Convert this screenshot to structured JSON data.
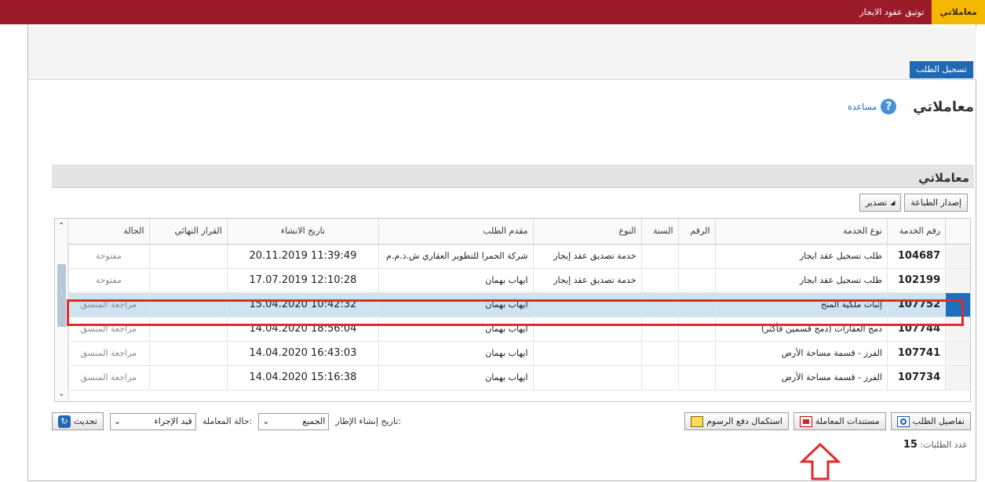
{
  "topbar": {
    "tabs": [
      {
        "label": "معاملاتي",
        "active": true
      },
      {
        "label": "توثيق عقود الايجار",
        "active": false
      }
    ]
  },
  "register_button": "تسجيل الطلب",
  "page_title": "معاملاتي",
  "help_label": "مساعدة",
  "help_icon": "?",
  "panel": {
    "title": "معاملاتي",
    "toolbar": {
      "print_label": "إصدار الطباعة",
      "export_label": "تصدير"
    }
  },
  "grid": {
    "columns": [
      "رقم الخدمة",
      "نوع الخدمة",
      "الرقم",
      "السنة",
      "النوع",
      "مقدم الطلب",
      "تاريخ الانشاء",
      "القرار النهائي",
      "الحالة"
    ],
    "rows": [
      [
        "104687",
        "طلب تسجيل عقد ايجار",
        "",
        "",
        "خدمة تصديق عقد إيجار",
        "شركة الحمرا للتطوير العقاري ش.ذ.م.م",
        "11:39:49 20.11.2019",
        "",
        "مفتوحة"
      ],
      [
        "102199",
        "طلب تسجيل عقد ايجار",
        "",
        "",
        "خدمة تصديق عقد إيجار",
        "ايهاب بهمان",
        "12:10:28 17.07.2019",
        "",
        "مفتوحة"
      ],
      [
        "107752",
        "إثبات ملكية المنح",
        "",
        "",
        "",
        "ايهاب بهمان",
        "10:42:32 15.04.2020",
        "",
        "مراجعة المنسق"
      ],
      [
        "107744",
        "دمج العقارات (دمج قسمين فأكثر)",
        "",
        "",
        "",
        "ايهاب بهمان",
        "18:56:04 14.04.2020",
        "",
        "مراجعة المنسق"
      ],
      [
        "107741",
        "الفرز - قسمة مساحة الأرض",
        "",
        "",
        "",
        "ايهاب بهمان",
        "16:43:03 14.04.2020",
        "",
        "مراجعة المنسق"
      ],
      [
        "107734",
        "الفرز - قسمة مساحة الأرض",
        "",
        "",
        "",
        "ايهاب بهمان",
        "15:16:38 14.04.2020",
        "",
        "مراجعة المنسق"
      ]
    ]
  },
  "bottom": {
    "details_label": "تفاصيل الطلب",
    "documents_label": "مستندات المعاملة",
    "fees_label": "استكمال دفع الرسوم",
    "created_label": "تاريخ إنشاء الإطار:",
    "created_value": "الجميع",
    "status_label": "حالة المعاملة:",
    "status_value": "قيد الإجراء",
    "refresh_label": "تحديث"
  },
  "count": {
    "label": "عدد الطلبات:",
    "value": "15"
  }
}
